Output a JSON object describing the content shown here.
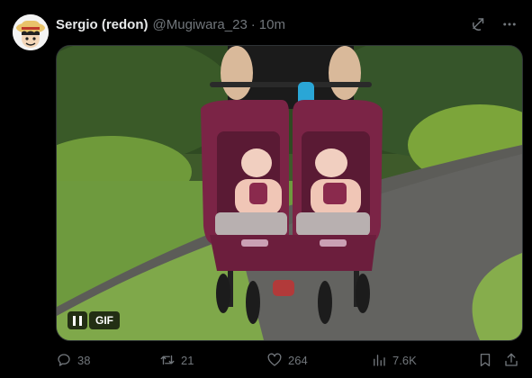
{
  "author": {
    "name": "Sergio (redon)",
    "handle": "@Mugiwara_23",
    "separator": "·",
    "time": "10m"
  },
  "media": {
    "type_label": "GIF",
    "playback": "playing"
  },
  "stats": {
    "replies": "38",
    "reposts": "21",
    "likes": "264",
    "views": "7.6K"
  },
  "icons": {
    "top_left": "grok-icon",
    "top_right": "more-icon",
    "pause": "pause-icon",
    "reply": "reply-icon",
    "repost": "repost-icon",
    "like": "heart-icon",
    "views": "analytics-icon",
    "bookmark": "bookmark-icon",
    "share": "share-icon"
  },
  "colors": {
    "background": "#000000",
    "text": "#e7e9ea",
    "muted": "#71767b"
  }
}
